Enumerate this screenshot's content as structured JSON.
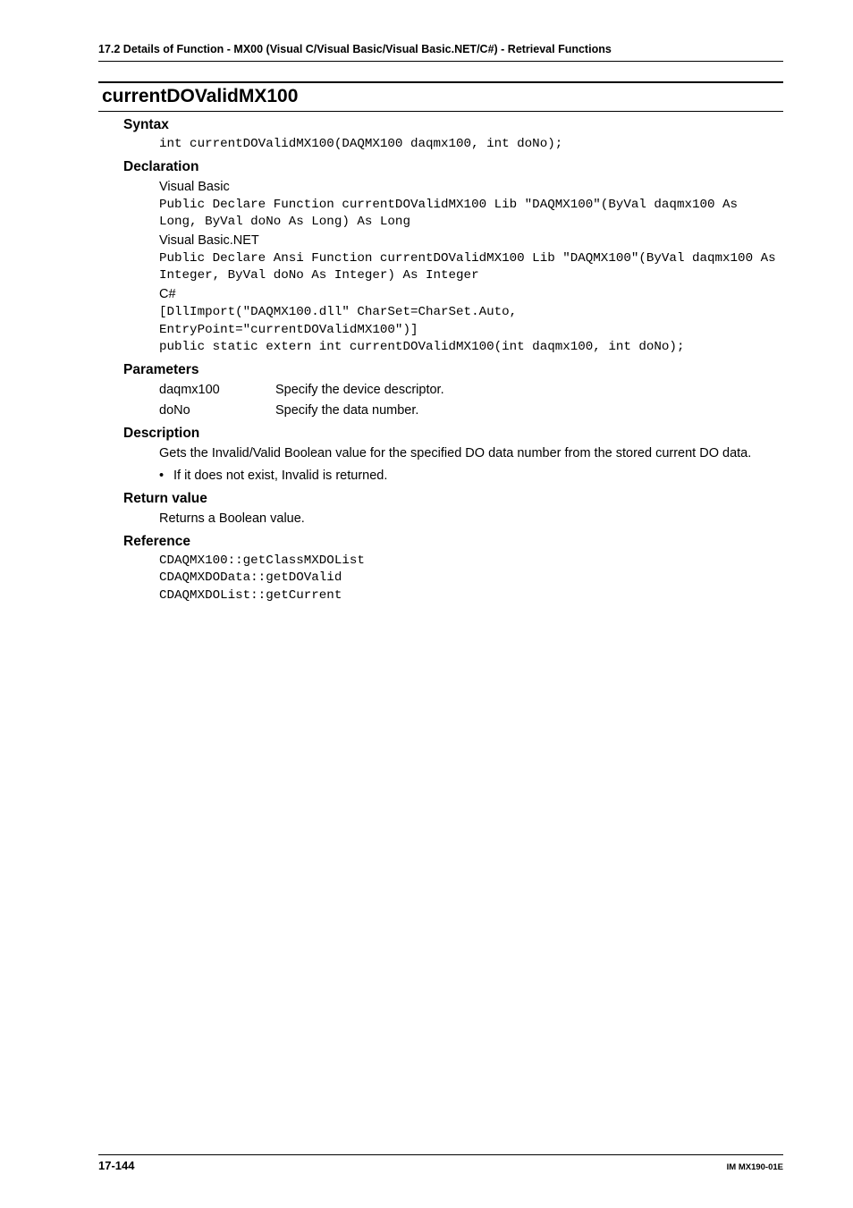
{
  "breadcrumb": "17.2  Details of  Function - MX00 (Visual C/Visual Basic/Visual Basic.NET/C#) - Retrieval Functions",
  "title": "currentDOValidMX100",
  "syntax": {
    "heading": "Syntax",
    "code": "int currentDOValidMX100(DAQMX100 daqmx100, int doNo);"
  },
  "declaration": {
    "heading": "Declaration",
    "vb_label": "Visual Basic",
    "vb_code": "Public Declare Function currentDOValidMX100 Lib \"DAQMX100\"(ByVal daqmx100 As Long, ByVal doNo As Long) As Long",
    "vbnet_label": "Visual Basic.NET",
    "vbnet_code": "Public Declare Ansi Function currentDOValidMX100 Lib \"DAQMX100\"(ByVal daqmx100 As Integer, ByVal doNo As Integer) As Integer",
    "cs_label": "C#",
    "cs_code": "[DllImport(\"DAQMX100.dll\" CharSet=CharSet.Auto, EntryPoint=\"currentDOValidMX100\")]\npublic static extern int currentDOValidMX100(int daqmx100, int doNo);"
  },
  "parameters": {
    "heading": "Parameters",
    "rows": [
      {
        "name": "daqmx100",
        "desc": "Specify the device descriptor."
      },
      {
        "name": "doNo",
        "desc": "Specify the data number."
      }
    ]
  },
  "description": {
    "heading": "Description",
    "text": "Gets the Invalid/Valid Boolean value for the specified DO data number from the stored current DO data.",
    "bullet": "If it does not exist, Invalid is returned."
  },
  "return": {
    "heading": "Return value",
    "text": "Returns a Boolean value."
  },
  "reference": {
    "heading": "Reference",
    "code": "CDAQMX100::getClassMXDOList\nCDAQMXDOData::getDOValid\nCDAQMXDOList::getCurrent"
  },
  "footer": {
    "page": "17-144",
    "docid": "IM MX190-01E"
  }
}
